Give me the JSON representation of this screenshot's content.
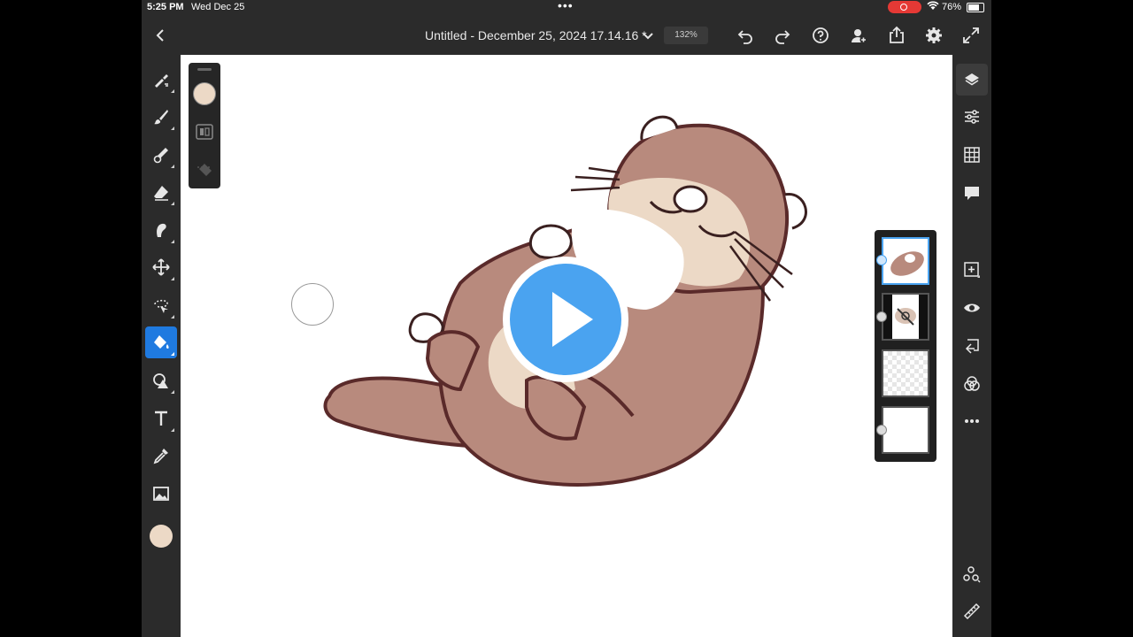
{
  "status_bar": {
    "time": "5:25 PM",
    "date": "Wed Dec 25",
    "battery": "76%"
  },
  "title_bar": {
    "document_title": "Untitled - December 25, 2024 17.14.16 *",
    "zoom": "132%"
  },
  "left_tools": [
    {
      "name": "pixel-brush",
      "icon": "brush-icon"
    },
    {
      "name": "live-brush",
      "icon": "paintbrush-icon"
    },
    {
      "name": "vector-brush",
      "icon": "pen-brush-icon"
    },
    {
      "name": "eraser",
      "icon": "eraser-icon"
    },
    {
      "name": "smudge",
      "icon": "smudge-icon"
    },
    {
      "name": "move-transform",
      "icon": "move-icon"
    },
    {
      "name": "lasso-selection",
      "icon": "lasso-icon"
    },
    {
      "name": "fill",
      "icon": "fill-bucket-icon",
      "active": true
    },
    {
      "name": "shapes",
      "icon": "shapes-icon"
    },
    {
      "name": "text",
      "icon": "text-icon"
    },
    {
      "name": "eyedropper",
      "icon": "eyedropper-icon"
    },
    {
      "name": "import-image",
      "icon": "image-icon"
    }
  ],
  "current_color": "#ecd9c6",
  "right_tools": [
    "layers-icon",
    "properties-icon",
    "grid-icon",
    "comment-icon",
    "add-layer-icon",
    "visibility-icon",
    "merge-icon",
    "blend-icon",
    "more-icon",
    "share-icon",
    "ruler-icon"
  ],
  "layers": [
    {
      "name": "otter-color-layer",
      "selected": true
    },
    {
      "name": "reference-layer",
      "hidden": true
    },
    {
      "name": "empty-layer"
    },
    {
      "name": "background-layer"
    }
  ],
  "video_overlay": {
    "icon": "play-icon"
  }
}
